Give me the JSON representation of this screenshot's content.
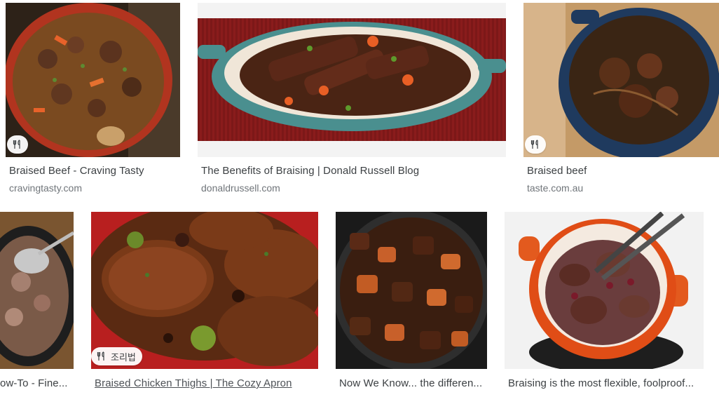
{
  "results": [
    {
      "title": "Braised Beef - Craving Tasty",
      "source": "cravingtasty.com",
      "badge": ""
    },
    {
      "title": "The Benefits of Braising | Donald Russell Blog",
      "source": "donaldrussell.com",
      "badge": ""
    },
    {
      "title": "Braised beef",
      "source": "taste.com.au",
      "badge": ""
    },
    {
      "title": "ow-To - Fine...",
      "source": "",
      "badge": ""
    },
    {
      "title": "Braised Chicken Thighs | The Cozy Apron",
      "source": "",
      "badge": "조리법"
    },
    {
      "title": "Now We Know... the differen...",
      "source": "",
      "badge": ""
    },
    {
      "title": "Braising is the most flexible, foolproof...",
      "source": "",
      "badge": ""
    }
  ],
  "icons": {
    "recipe_badge": "fork-knife-icon"
  }
}
